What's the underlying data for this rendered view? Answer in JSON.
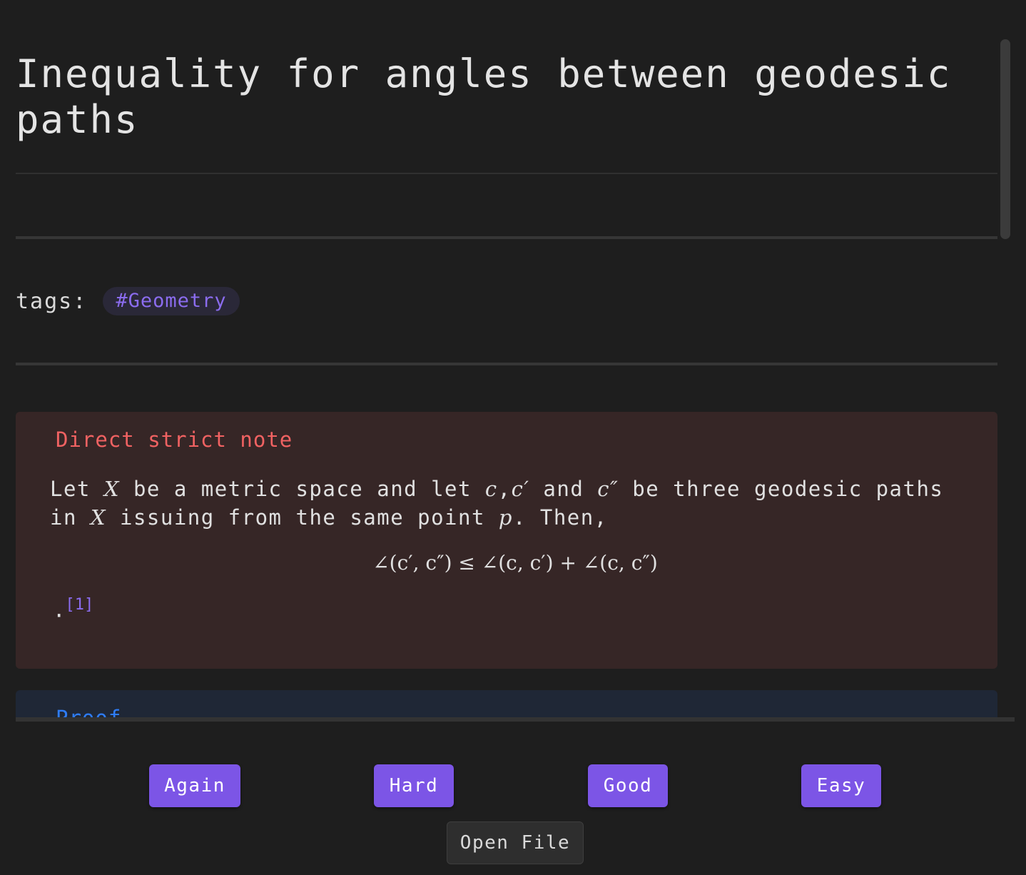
{
  "note": {
    "title": "Inequality for angles between geodesic paths",
    "tags_label": "tags:",
    "tags": [
      "#Geometry"
    ]
  },
  "callout": {
    "title": "Direct strict note",
    "body": {
      "t1": "Let ",
      "X": "X",
      "t2": " be a metric space and let ",
      "c": "c",
      "comma": ",",
      "c_prime": "c′",
      "t3": " and ",
      "c_dprime": "c″",
      "t4": " be three geodesic paths in ",
      "X2": "X",
      "t5": " issuing from the same point ",
      "p": "p",
      "t6": ". Then,"
    },
    "equation": "∠(c′, c″) ≤ ∠(c, c′) + ∠(c, c″)",
    "trailing_period": ".",
    "footnote_ref": "[1]"
  },
  "proof_callout": {
    "title": "Proof"
  },
  "buttons": {
    "again": "Again",
    "hard": "Hard",
    "good": "Good",
    "easy": "Easy",
    "open_file": "Open File"
  }
}
